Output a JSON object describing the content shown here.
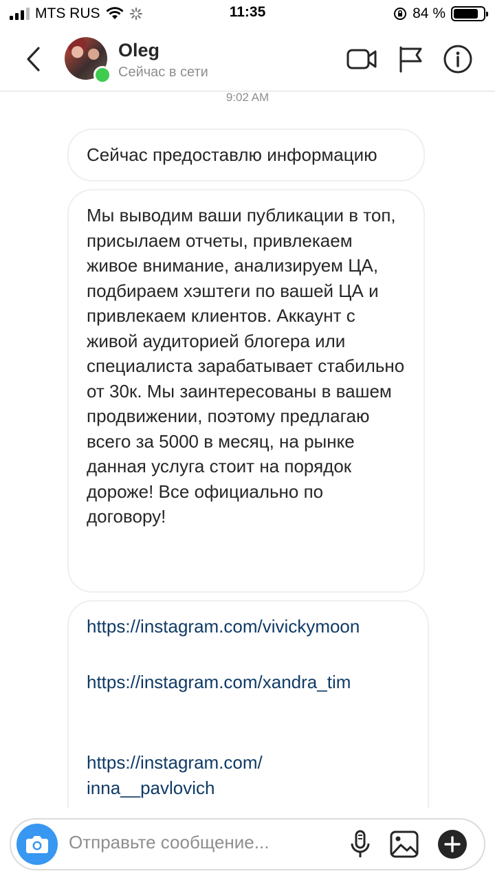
{
  "status_bar": {
    "carrier": "MTS RUS",
    "time": "11:35",
    "battery_percent": "84 %",
    "battery_level": 0.84
  },
  "header": {
    "contact_name": "Oleg",
    "presence": "Сейчас в сети",
    "icons": [
      "back-arrow-icon",
      "video-call-icon",
      "flag-icon",
      "info-icon"
    ],
    "online_color": "#3ecb4f"
  },
  "chat": {
    "timestamp": "9:02 AM",
    "messages": [
      {
        "text": "Сейчас предоставлю информацию"
      },
      {
        "text": "Мы выводим ваши публикации в топ, присылаем отчеты, привлекаем живое внимание, анализируем ЦА, подбираем хэштеги по вашей ЦА и привлекаем клиентов. Аккаунт с живой аудиторией блогера или специалиста зарабатывает стабильно от 30к. Мы заинтересованы в вашем продвижении, поэтому предлагаю всего за 5000 в месяц, на рынке данная услуга стоит на порядок дороже! Все официально по договору!"
      }
    ],
    "links": [
      "https://instagram.com/vivickymoon",
      "https://instagram.com/xandra_tim",
      "https://instagram.com/ inna__pavlovich"
    ]
  },
  "composer": {
    "placeholder": "Отправьте сообщение...",
    "icons": [
      "camera-icon",
      "microphone-icon",
      "gallery-icon",
      "add-icon"
    ],
    "camera_color": "#3897f0"
  }
}
